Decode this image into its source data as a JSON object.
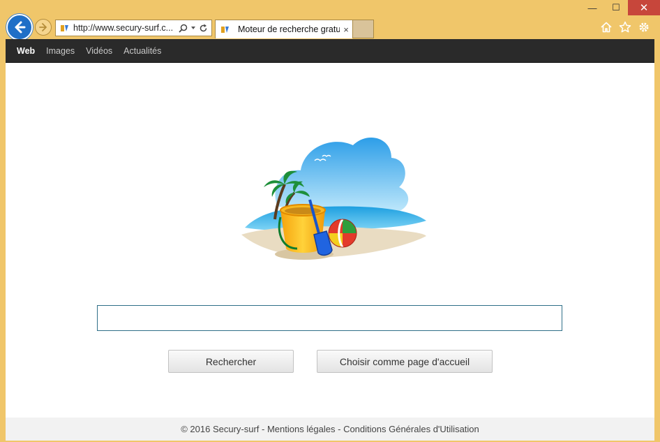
{
  "browser": {
    "address": "http://www.secury-surf.c...",
    "tab_title": "Moteur de recherche gratui...",
    "tab_close": "×",
    "window": {
      "minimize": "—",
      "maximize": "☐",
      "close": "✕"
    },
    "icons": {
      "back": "back-arrow-icon",
      "forward": "forward-arrow-icon",
      "search": "search-icon",
      "refresh": "refresh-icon",
      "home": "home-icon",
      "favorites": "star-icon",
      "tools": "gear-icon"
    }
  },
  "nav": {
    "items": [
      {
        "label": "Web",
        "active": true
      },
      {
        "label": "Images",
        "active": false
      },
      {
        "label": "Vidéos",
        "active": false
      },
      {
        "label": "Actualités",
        "active": false
      }
    ]
  },
  "search": {
    "value": "",
    "placeholder": "",
    "submit_label": "Rechercher",
    "homepage_label": "Choisir comme page d'accueil"
  },
  "footer": {
    "text": "© 2016 Secury-surf - Mentions légales - Conditions Générales d'Utilisation"
  },
  "colors": {
    "chrome": "#f0c66a",
    "navbar": "#2a2a2a",
    "accent": "#1f6fc7",
    "input_border": "#2f6f88"
  }
}
